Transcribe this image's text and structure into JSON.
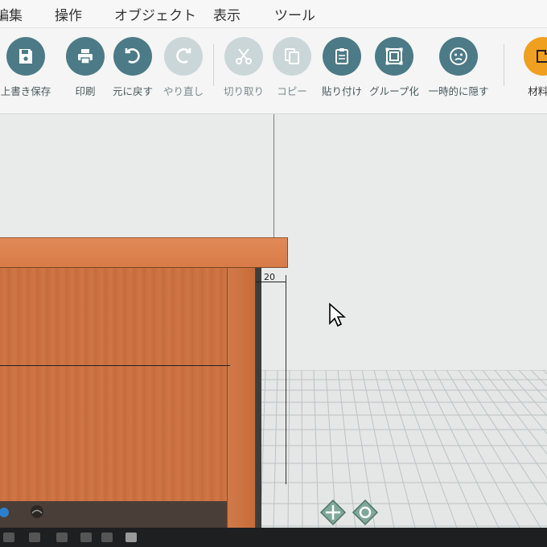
{
  "menu": {
    "items": [
      "編集",
      "操作",
      "オブジェクト",
      "表示",
      "ツール"
    ]
  },
  "toolbar": {
    "overwrite_save": "上書き保存",
    "print": "印刷",
    "undo": "元に戻す",
    "redo": "やり直し",
    "cut": "切り取り",
    "copy": "コピー",
    "paste": "貼り付け",
    "group": "グループ化",
    "temp_hide": "一時的に隠す",
    "material": "材料の"
  },
  "canvas": {
    "dimension_label": "20"
  },
  "colors": {
    "toolbar_button": "#4c7a87",
    "toolbar_button_disabled": "#cbd6d8",
    "accent_orange": "#f0a020",
    "wood": "#d07a49"
  }
}
